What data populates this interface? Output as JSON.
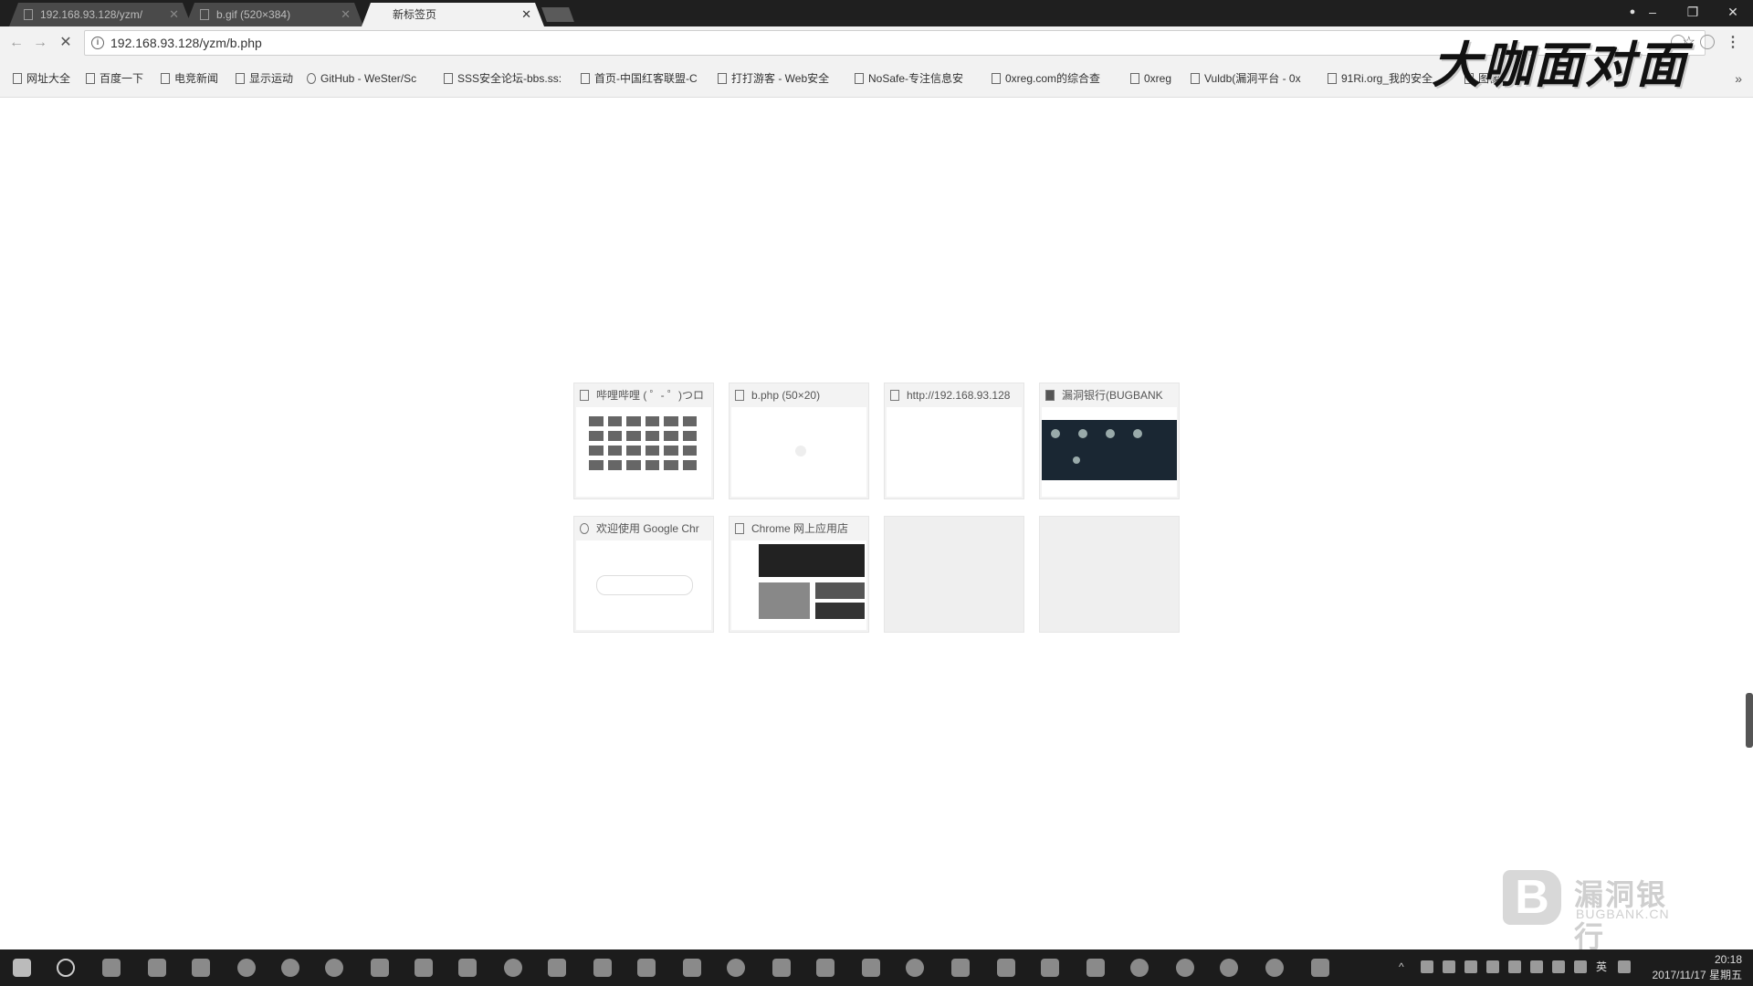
{
  "tabs": [
    {
      "title": "192.168.93.128/yzm/",
      "active": false
    },
    {
      "title": "b.gif (520×384)",
      "active": false
    },
    {
      "title": "新标签页",
      "active": true
    }
  ],
  "address_bar": {
    "url": "192.168.93.128/yzm/b.php"
  },
  "bookmarks": [
    "网址大全",
    "百度一下",
    "电竞新闻",
    "显示运动",
    "GitHub - WeSter/Sc",
    "SSS安全论坛-bbs.ss:",
    "首页-中国红客联盟-C",
    "打打游客 - Web安全",
    "NoSafe-专注信息安",
    "0xreg.com的综合查",
    "0xreg",
    "Vuldb(漏洞平台 - 0x",
    "91Ri.org_我的安全",
    "图像"
  ],
  "bookmarks_more": "»",
  "watermark_top": "大咖面对面",
  "most_visited": [
    {
      "title": "哔哩哔哩 ( ゜- ゜)つロ",
      "thumb": "grid"
    },
    {
      "title": "b.php (50×20)",
      "thumb": "blank"
    },
    {
      "title": "http://192.168.93.128",
      "thumb": "blank"
    },
    {
      "title": "漏洞银行(BUGBANK",
      "thumb": "dark"
    },
    {
      "title": "欢迎使用 Google Chr",
      "thumb": "welcome"
    },
    {
      "title": "Chrome 网上应用店",
      "thumb": "store"
    }
  ],
  "watermark_bottom": {
    "cn": "漏洞银行",
    "en": "BUGBANK.CN",
    "logo": "B"
  },
  "clock": {
    "time": "20:18",
    "date": "2017/11/17 星期五"
  },
  "tray_lang": "英"
}
